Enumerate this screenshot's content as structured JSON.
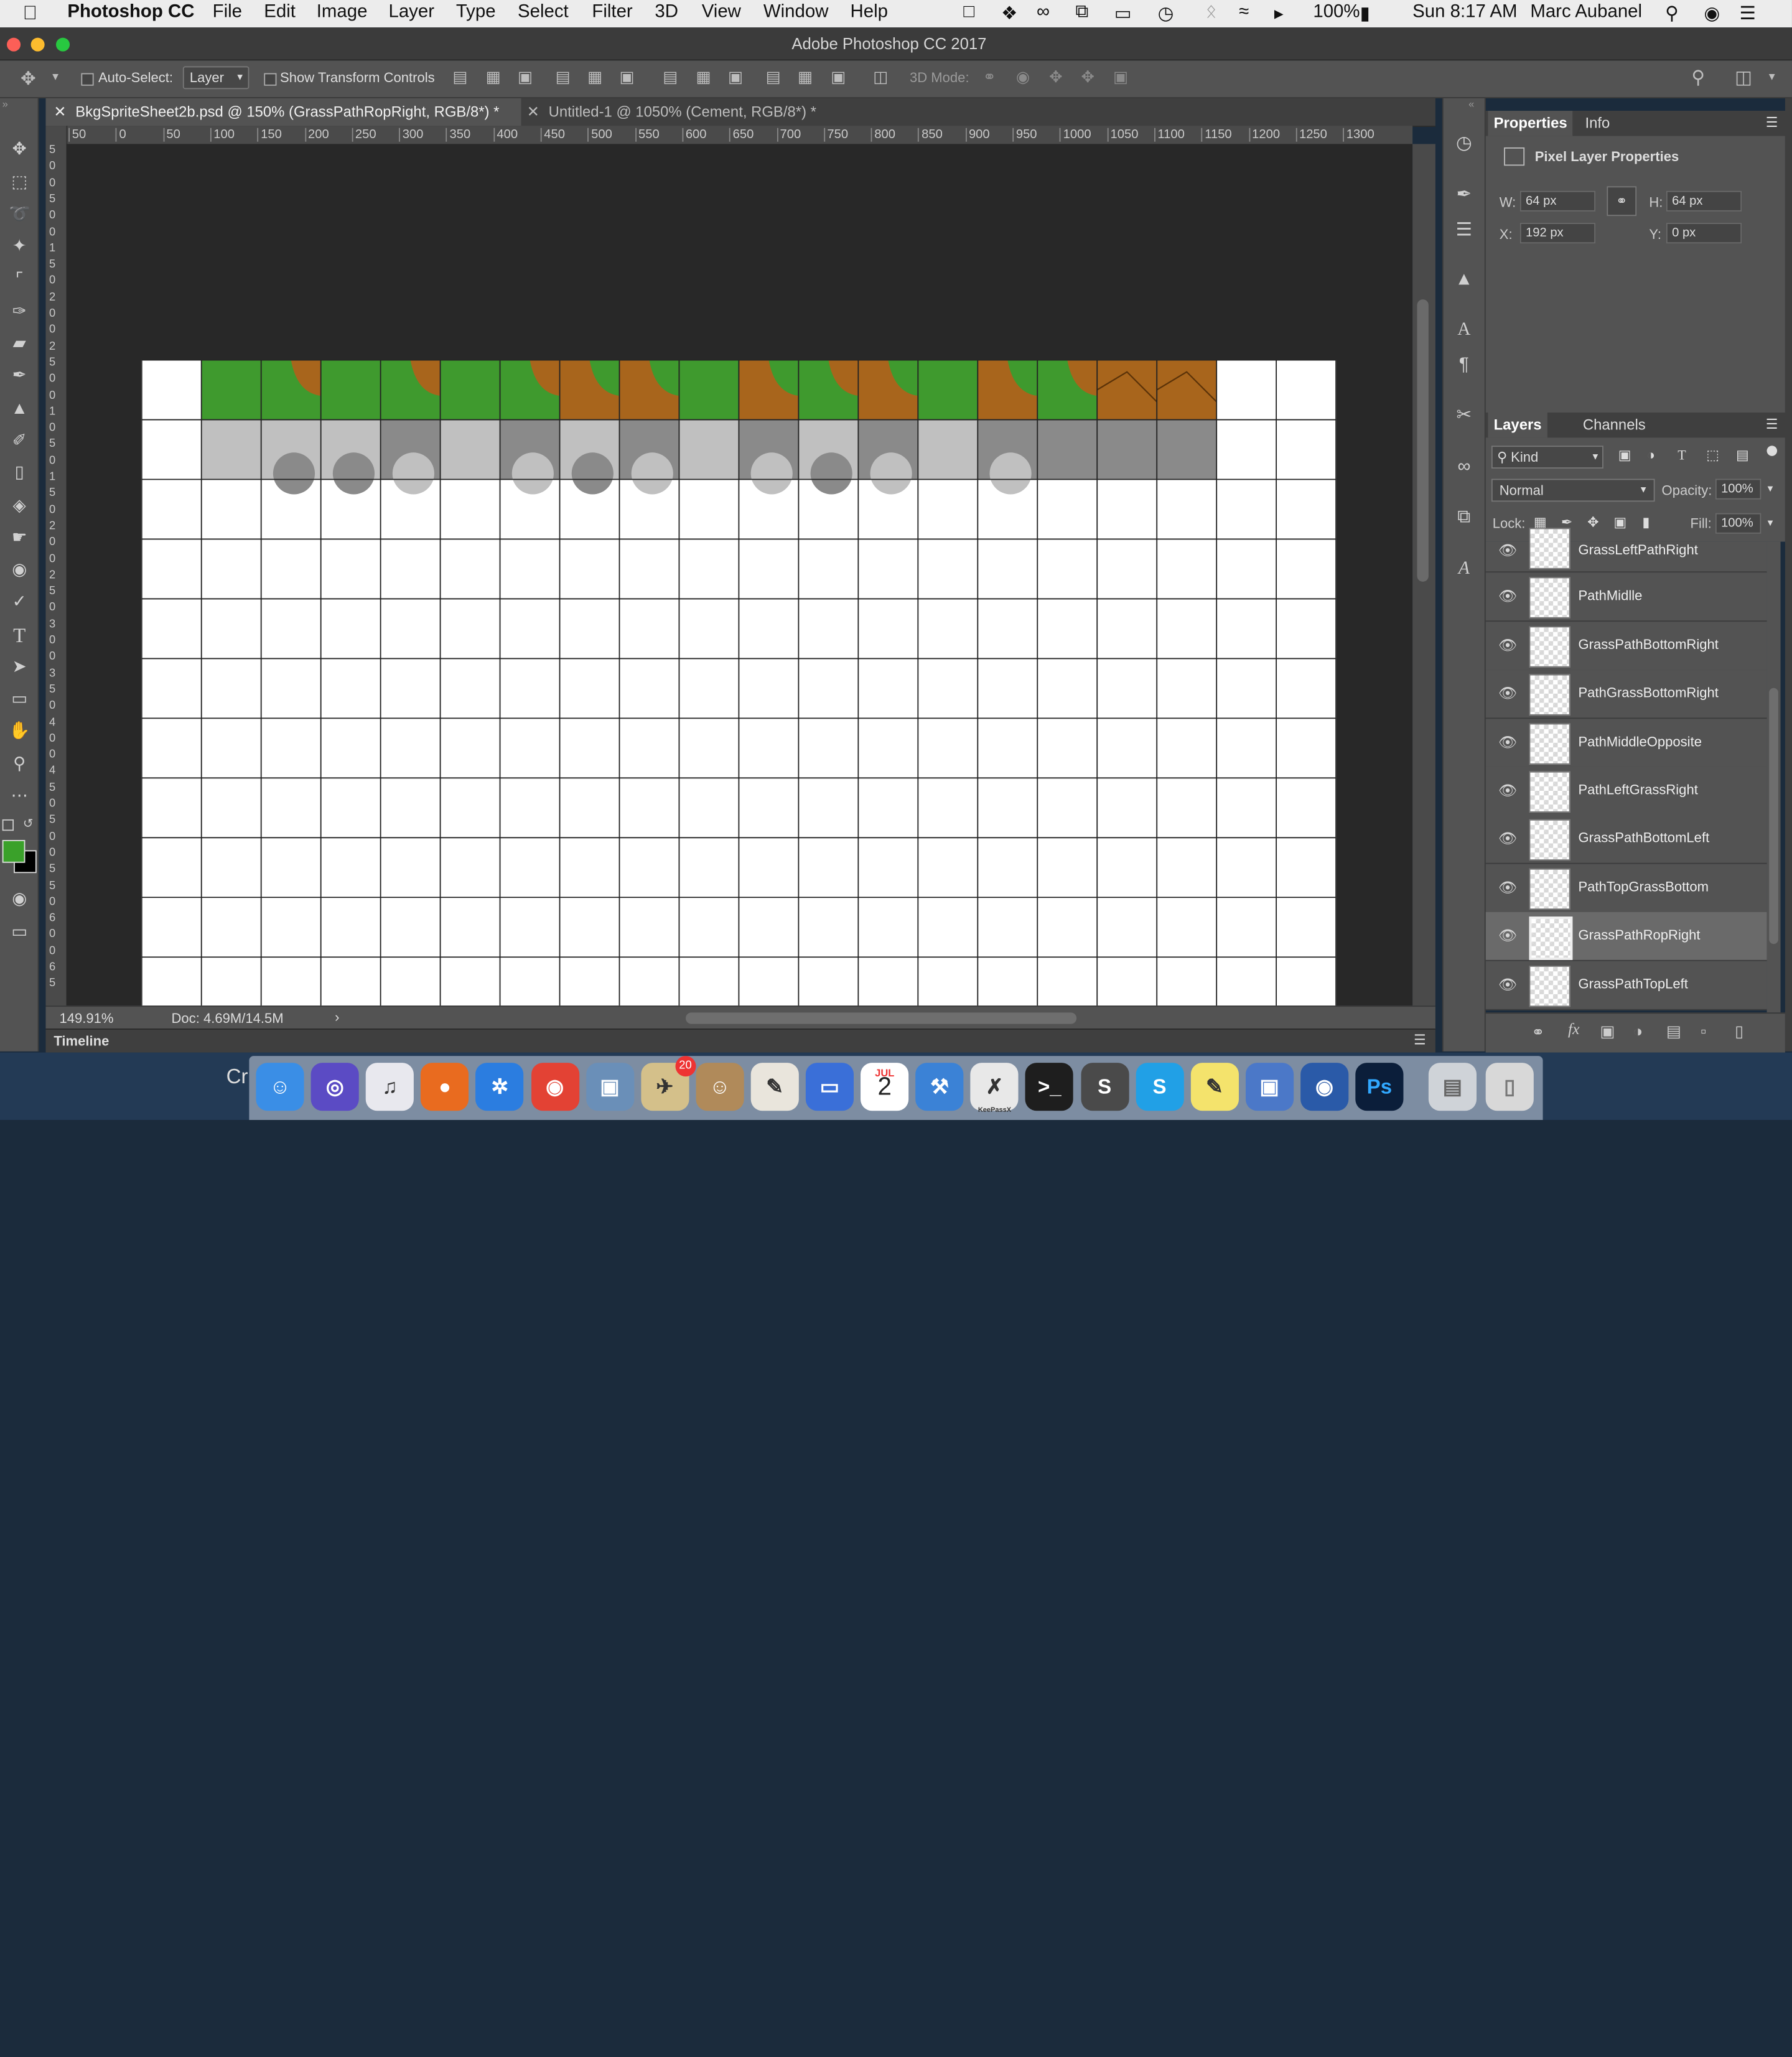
{
  "menubar": {
    "app_name": "Photoshop CC",
    "items": [
      "File",
      "Edit",
      "Image",
      "Layer",
      "Type",
      "Select",
      "Filter",
      "3D",
      "View",
      "Window",
      "Help"
    ],
    "battery": "100%",
    "clock": "Sun 8:17 AM",
    "user": "Marc Aubanel"
  },
  "window": {
    "title": "Adobe Photoshop CC 2017"
  },
  "options_bar": {
    "auto_select_label": "Auto-Select:",
    "auto_select_value": "Layer",
    "show_transform_label": "Show Transform Controls",
    "mode_3d_label": "3D Mode:"
  },
  "tabs": [
    {
      "label": "BkgSpriteSheet2b.psd @ 150% (GrassPathRopRight, RGB/8*) *",
      "active": true
    },
    {
      "label": "Untitled-1 @ 1050% (Cement, RGB/8*) *",
      "active": false
    }
  ],
  "ruler": {
    "h_ticks": [
      "50",
      "0",
      "50",
      "100",
      "150",
      "200",
      "250",
      "300",
      "350",
      "400",
      "450",
      "500",
      "550",
      "600",
      "650",
      "700",
      "750",
      "800",
      "850",
      "900",
      "950",
      "1000",
      "1050",
      "1100",
      "1150",
      "1200",
      "1250",
      "1300"
    ],
    "v_ticks": [
      "5",
      "0",
      "0",
      "5",
      "0",
      "0",
      "1",
      "5",
      "0",
      "2",
      "0",
      "0",
      "2",
      "5",
      "0",
      "0",
      "1",
      "0",
      "5",
      "0",
      "1",
      "5",
      "0",
      "2",
      "0",
      "0",
      "2",
      "5",
      "0",
      "3",
      "0",
      "0",
      "3",
      "5",
      "0",
      "4",
      "0",
      "0",
      "4",
      "5",
      "0",
      "5",
      "0",
      "0",
      "5",
      "5",
      "0",
      "6",
      "0",
      "0",
      "6",
      "5"
    ]
  },
  "status": {
    "zoom": "149.91%",
    "doc_size": "Doc: 4.69M/14.5M"
  },
  "timeline_label": "Timeline",
  "properties": {
    "tabs": [
      "Properties",
      "Info"
    ],
    "heading": "Pixel Layer Properties",
    "w_label": "W:",
    "w_value": "64 px",
    "h_label": "H:",
    "h_value": "64 px",
    "x_label": "X:",
    "x_value": "192 px",
    "y_label": "Y:",
    "y_value": "0 px"
  },
  "layers_panel": {
    "tabs": [
      "Layers",
      "Channels"
    ],
    "filter_value": "Kind",
    "blend_mode": "Normal",
    "opacity_label": "Opacity:",
    "opacity_value": "100%",
    "lock_label": "Lock:",
    "fill_label": "Fill:",
    "fill_value": "100%",
    "layers": [
      {
        "name": "GrassLeftPathRight",
        "selected": false
      },
      {
        "name": "PathMidlle",
        "selected": false
      },
      {
        "name": "GrassPathBottomRight",
        "selected": false
      },
      {
        "name": "PathGrassBottomRight",
        "selected": false
      },
      {
        "name": "PathMiddleOpposite",
        "selected": false
      },
      {
        "name": "PathLeftGrassRight",
        "selected": false
      },
      {
        "name": "GrassPathBottomLeft",
        "selected": false
      },
      {
        "name": "PathTopGrassBottom",
        "selected": false
      },
      {
        "name": "GrassPathRopRight",
        "selected": true
      },
      {
        "name": "GrassPathTopLeft",
        "selected": false
      }
    ]
  },
  "dock": {
    "partial_label": "Cr",
    "calendar_month": "JUL",
    "calendar_day": "2",
    "mail_badge": "20",
    "keepass_label": "KeePassX",
    "ps_label": "Ps",
    "apps": [
      "finder-icon",
      "siri-icon",
      "itunes-icon",
      "firefox-icon",
      "safari-icon",
      "chrome-icon",
      "preview-icon",
      "mail-icon",
      "contacts-icon",
      "texteditor-icon",
      "keynote-icon",
      "calendar-icon",
      "xcode-icon",
      "keepassx-icon",
      "terminal-icon",
      "sublime-icon",
      "skype-icon",
      "notes-icon",
      "vmware-icon",
      "photobooth-icon",
      "photoshop-icon"
    ]
  },
  "colors": {
    "foreground": "#3aa12a",
    "background": "#000000",
    "grass": "#3f9a2e",
    "dirt": "#a8651c",
    "path_light": "#c0c0c0",
    "path_dark": "#8a8a8a"
  },
  "sprite_grid": {
    "cols": 20,
    "rows": 11,
    "top_row_tiles": [
      "grass",
      "grass-dirt",
      "grass",
      "grass-dirt",
      "grass",
      "grass-dirt",
      "dirt-grass",
      "dirt-grass",
      "grass",
      "dirt-grass",
      "grass-dirt",
      "dirt-grass",
      "grass",
      "dirt-grass",
      "grass-dirt",
      "dirt",
      "dirt"
    ],
    "second_row_tiles": [
      "light",
      "light-dark",
      "light-dark",
      "dark-light",
      "light",
      "dark-light",
      "light-dark",
      "dark-light",
      "light",
      "dark-light",
      "light-dark",
      "dark-light",
      "light",
      "dark-light",
      "dark",
      "dark",
      "dark"
    ]
  }
}
